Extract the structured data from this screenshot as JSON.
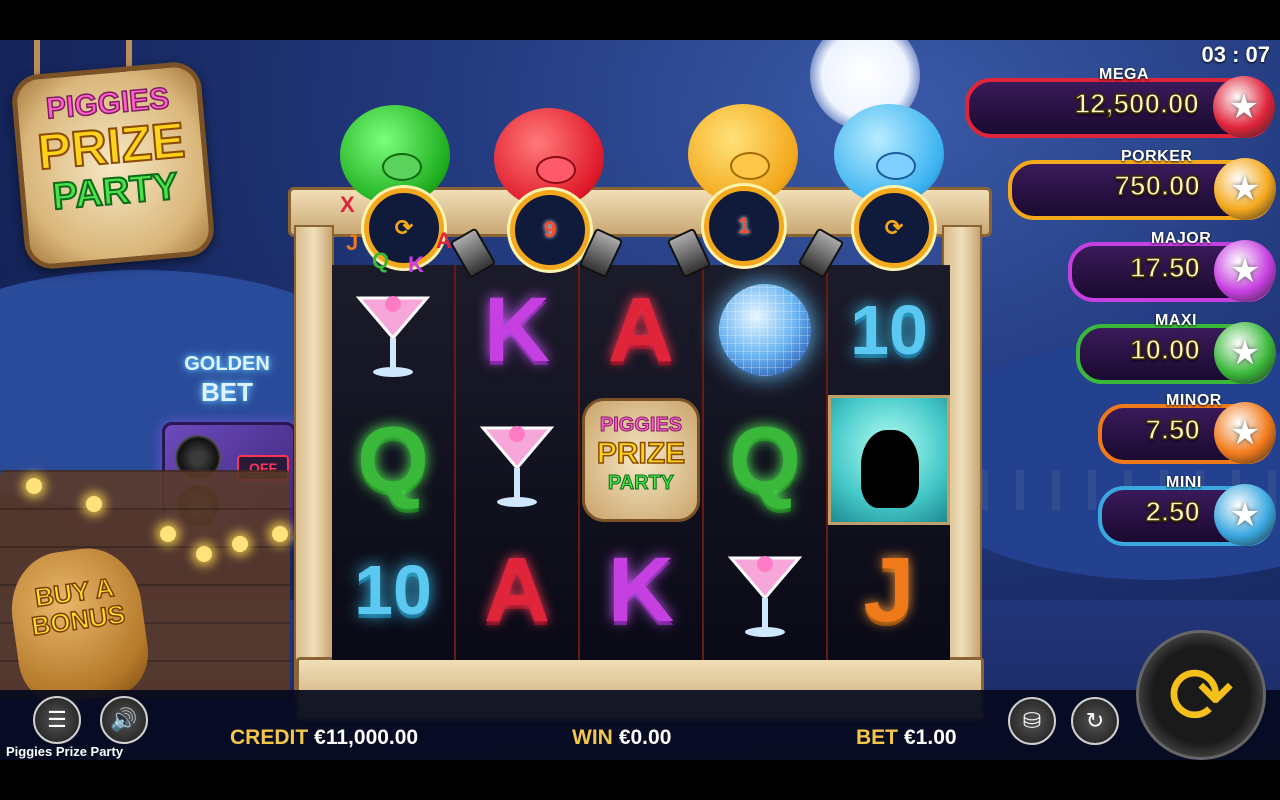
{
  "game": {
    "title": "Piggies Prize Party",
    "logo": {
      "line1": "PIGGIES",
      "line2": "PRIZE",
      "line3": "PARTY"
    },
    "clock": "03 : 07"
  },
  "golden_bet": {
    "line1": "GOLDEN",
    "line2": "BET",
    "toggle_label": "OFF"
  },
  "buy_bonus": {
    "line1": "BUY A",
    "line2": "BONUS"
  },
  "pig_modifiers": [
    {
      "pig": "green",
      "ring_value": "",
      "floaters": [
        "X",
        "J",
        "Q",
        "K",
        "A"
      ]
    },
    {
      "pig": "red",
      "ring_value": "9"
    },
    {
      "pig": "yellow",
      "ring_value": "1"
    },
    {
      "pig": "blue",
      "ring_value": ""
    }
  ],
  "reels": [
    [
      "cocktail",
      "Q",
      "10"
    ],
    [
      "K",
      "cocktail",
      "A"
    ],
    [
      "A",
      "logo",
      "K"
    ],
    [
      "disco-ball",
      "Q",
      "cocktail"
    ],
    [
      "10",
      "pig-silhouette",
      "J"
    ]
  ],
  "jackpots": [
    {
      "name": "MEGA",
      "value": "12,500.00",
      "color": "#e0243a"
    },
    {
      "name": "PORKER",
      "value": "750.00",
      "color": "#f4a81c"
    },
    {
      "name": "MAJOR",
      "value": "17.50",
      "color": "#c63fe0"
    },
    {
      "name": "MAXI",
      "value": "10.00",
      "color": "#3ab83a"
    },
    {
      "name": "MINOR",
      "value": "7.50",
      "color": "#f07a1a"
    },
    {
      "name": "MINI",
      "value": "2.50",
      "color": "#3aa8e0"
    }
  ],
  "hud": {
    "credit_label": "CREDIT",
    "credit_value": "€11,000.00",
    "win_label": "WIN",
    "win_value": "€0.00",
    "bet_label": "BET",
    "bet_value": "€1.00"
  },
  "icons": {
    "menu": "hamburger-icon",
    "sound": "speaker-icon",
    "coins": "coin-stack-icon",
    "autoplay": "autoplay-icon",
    "spin": "spin-arrows-icon"
  }
}
